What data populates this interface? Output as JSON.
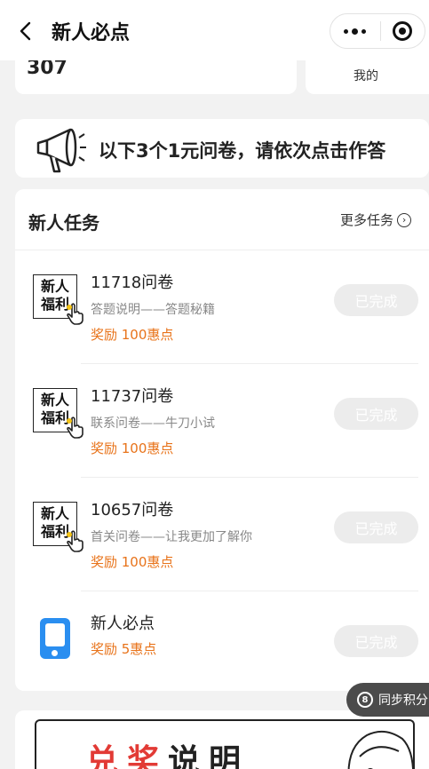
{
  "header": {
    "title": "新人必点"
  },
  "top": {
    "count": "307",
    "mine_label": "我的"
  },
  "notice": {
    "text": "以下3个1元问卷，请依次点击作答"
  },
  "tasks_card": {
    "title": "新人任务",
    "more_label": "更多任务",
    "chevron_glyph": "›"
  },
  "tasks": [
    {
      "badge_line1": "新人",
      "badge_line2": "福利",
      "name": "11718问卷",
      "desc": "答题说明——答题秘籍",
      "reward": "奖励 100惠点",
      "button": "已完成",
      "icon": "hand-pointer-icon"
    },
    {
      "badge_line1": "新人",
      "badge_line2": "福利",
      "name": "11737问卷",
      "desc": "联系问卷——牛刀小试",
      "reward": "奖励 100惠点",
      "button": "已完成",
      "icon": "hand-pointer-icon"
    },
    {
      "badge_line1": "新人",
      "badge_line2": "福利",
      "name": "10657问卷",
      "desc": "首关问卷——让我更加了解你",
      "reward": "奖励 100惠点",
      "button": "已完成",
      "icon": "hand-pointer-icon"
    },
    {
      "name": "新人必点",
      "reward": "奖励 5惠点",
      "button": "已完成",
      "icon": "phone-icon"
    }
  ],
  "sync": {
    "label": "同步积分",
    "icon_glyph": "8"
  },
  "banner": {
    "title_part1": "兑奖",
    "title_part2": "说明"
  },
  "colors": {
    "reward": "#e8731a",
    "phone": "#2a8ef0",
    "banner_red": "#e23a35"
  }
}
